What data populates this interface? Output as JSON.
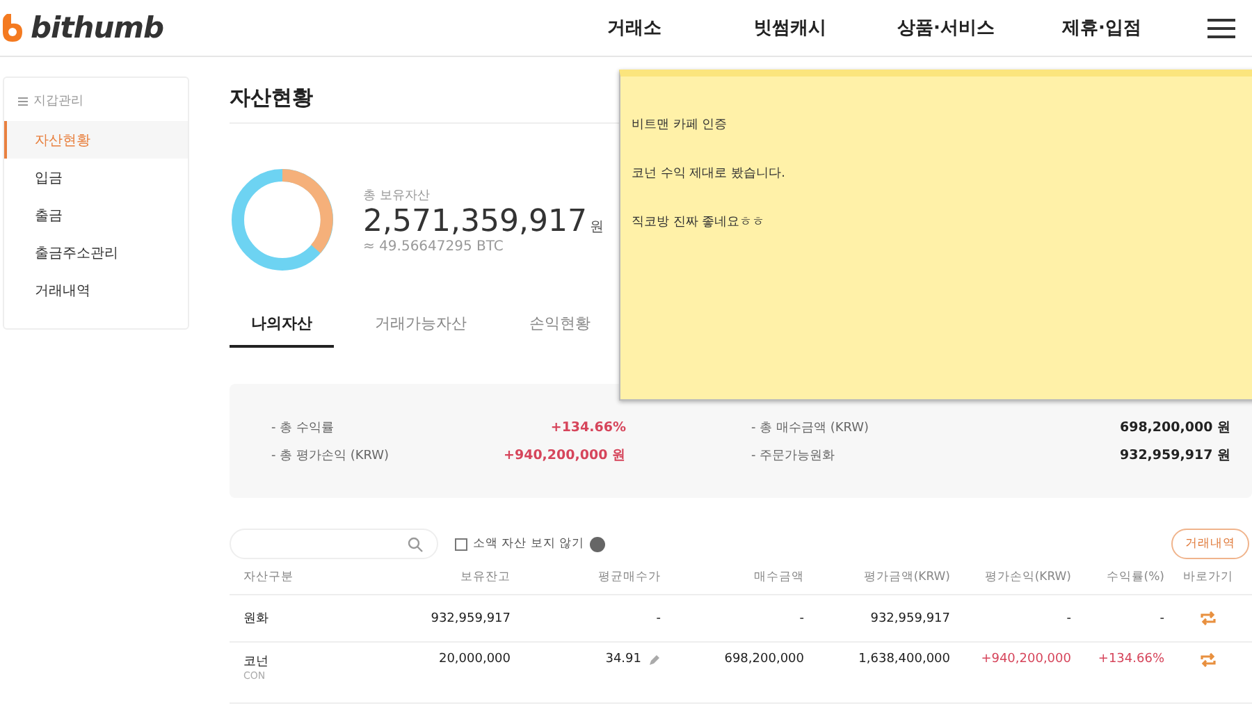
{
  "header": {
    "logo": "bithumb",
    "nav": [
      "거래소",
      "빗썸캐시",
      "상품·서비스",
      "제휴·입점"
    ]
  },
  "sidebar": {
    "title": "지갑관리",
    "items": [
      {
        "label": "자산현황",
        "selected": true
      },
      {
        "label": "입금",
        "selected": false
      },
      {
        "label": "출금",
        "selected": false
      },
      {
        "label": "출금주소관리",
        "selected": false
      },
      {
        "label": "거래내역",
        "selected": false
      }
    ]
  },
  "page_title": "자산현황",
  "total": {
    "label": "총 보유자산",
    "amount": "2,571,359,917",
    "unit": "원",
    "btc": "≈ 49.56647295 BTC"
  },
  "tabs": [
    {
      "label": "나의자산",
      "selected": true
    },
    {
      "label": "거래가능자산",
      "selected": false
    },
    {
      "label": "손익현황",
      "selected": false
    }
  ],
  "summary": [
    {
      "label": "- 총 수익률",
      "value": "+134.66%",
      "color": "#d6455b"
    },
    {
      "label": "- 총 매수금액 (KRW)",
      "value": "698,200,000 원",
      "color": "#222222"
    },
    {
      "label": "- 총 평가손익 (KRW)",
      "value": "+940,200,000 원",
      "color": "#d6455b"
    },
    {
      "label": "- 주문가능원화",
      "value": "932,959,917 원",
      "color": "#222222"
    }
  ],
  "filter": {
    "checkbox_label": "소액 자산 보지 않기",
    "checked": false,
    "history_button": "거래내역"
  },
  "table": {
    "columns": [
      "자산구분",
      "보유잔고",
      "평균매수가",
      "매수금액",
      "평가금액(KRW)",
      "평가손익(KRW)",
      "수익률(%)",
      "바로가기"
    ],
    "rows": [
      {
        "name": "원화",
        "balance": "932,959,917",
        "avg_price": "-",
        "editable": false,
        "buy_amount": "-",
        "eval_amount": "932,959,917",
        "profit": "-",
        "rate": "-",
        "positive": false
      },
      {
        "name": "코넌",
        "ticker": "CON",
        "balance": "20,000,000",
        "avg_price": "34.91",
        "editable": true,
        "buy_amount": "698,200,000",
        "eval_amount": "1,638,400,000",
        "profit": "+940,200,000",
        "rate": "+134.66%",
        "positive": true
      }
    ]
  },
  "note": {
    "lines": [
      "비트맨 카페 인증",
      "코넌 수익 제대로 봤습니다.",
      "직코방 진짜 좋네요ㅎㅎ"
    ]
  }
}
